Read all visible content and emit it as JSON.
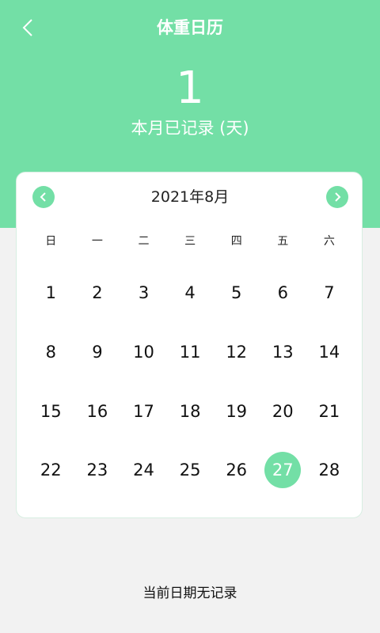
{
  "header": {
    "title": "体重日历",
    "record_count": "1",
    "record_label": "本月已记录 (天)"
  },
  "calendar": {
    "month_title": "2021年8月",
    "weekdays": [
      "日",
      "一",
      "二",
      "三",
      "四",
      "五",
      "六"
    ],
    "weeks": [
      [
        "1",
        "2",
        "3",
        "4",
        "5",
        "6",
        "7"
      ],
      [
        "8",
        "9",
        "10",
        "11",
        "12",
        "13",
        "14"
      ],
      [
        "15",
        "16",
        "17",
        "18",
        "19",
        "20",
        "21"
      ],
      [
        "22",
        "23",
        "24",
        "25",
        "26",
        "27",
        "28"
      ]
    ],
    "selected_day": "27"
  },
  "status_text": "当前日期无记录",
  "colors": {
    "accent": "#73dfa6",
    "background": "#f2f2f2",
    "card": "#ffffff"
  },
  "icons": {
    "back": "back-chevron-icon",
    "prev": "chevron-left-icon",
    "next": "chevron-right-icon"
  }
}
